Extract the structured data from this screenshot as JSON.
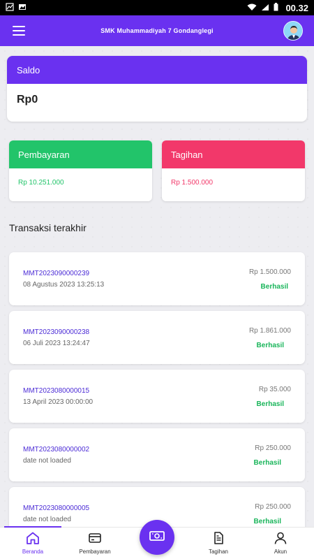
{
  "status_bar": {
    "time": "00.32"
  },
  "app_bar": {
    "title": "SMK Muhammadiyah 7 Gondanglegi"
  },
  "saldo": {
    "label": "Saldo",
    "amount": "Rp0"
  },
  "pembayaran": {
    "label": "Pembayaran",
    "amount": "Rp 10.251.000"
  },
  "tagihan": {
    "label": "Tagihan",
    "amount": "Rp 1.500.000"
  },
  "section": {
    "title": "Transaksi terakhir"
  },
  "transactions": [
    {
      "code": "MMT2023090000239",
      "date": "08 Agustus 2023 13:25:13",
      "amount": "Rp 1.500.000",
      "status": "Berhasil"
    },
    {
      "code": "MMT2023090000238",
      "date": "06 Juli 2023 13:24:47",
      "amount": "Rp 1.861.000",
      "status": "Berhasil"
    },
    {
      "code": "MMT2023080000015",
      "date": "13 April 2023 00:00:00",
      "amount": "Rp 35.000",
      "status": "Berhasil"
    },
    {
      "code": "MMT2023080000002",
      "date": "date not loaded",
      "amount": "Rp 250.000",
      "status": "Berhasil"
    },
    {
      "code": "MMT2023080000005",
      "date": "date not loaded",
      "amount": "Rp 250.000",
      "status": "Berhasil"
    }
  ],
  "bottom_nav": {
    "beranda": "Beranda",
    "pembayaran": "Pembayaran",
    "tagihan": "Tagihan",
    "akun": "Akun"
  },
  "colors": {
    "primary": "#6a31f0",
    "pembayaran": "#22c46a",
    "tagihan": "#f2386a",
    "success": "#19b55a"
  },
  "icons": {
    "menu": "hamburger-icon",
    "avatar": "avatar",
    "home": "home-icon",
    "card": "card-icon",
    "money": "money-icon",
    "document": "document-icon",
    "user": "user-icon"
  }
}
